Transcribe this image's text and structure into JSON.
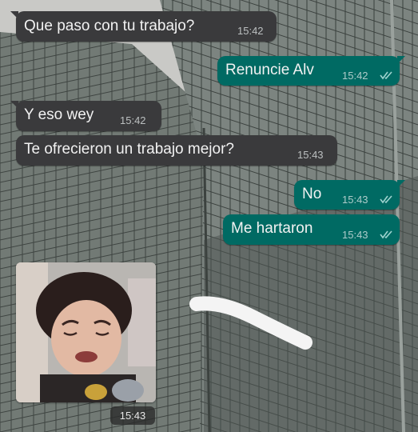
{
  "chat": {
    "messages": [
      {
        "direction": "incoming",
        "text": "Que paso con tu trabajo?",
        "time": "15:42"
      },
      {
        "direction": "outgoing",
        "text": "Renuncie Alv",
        "time": "15:42",
        "status": "read"
      },
      {
        "direction": "incoming",
        "text": "Y eso wey",
        "time": "15:42"
      },
      {
        "direction": "incoming",
        "text": "Te ofrecieron un trabajo mejor?",
        "time": "15:43"
      },
      {
        "direction": "outgoing",
        "text": "No",
        "time": "15:43",
        "status": "read"
      },
      {
        "direction": "outgoing",
        "text": "Me hartaron",
        "time": "15:43",
        "status": "read"
      },
      {
        "direction": "incoming",
        "type": "image",
        "image_desc": "crying-child-photo",
        "time": "15:43"
      }
    ]
  },
  "colors": {
    "incoming_bubble": "#3a3a3c",
    "outgoing_bubble": "#006a63",
    "read_ticks": "#9fd3cf"
  },
  "icons": {
    "read_receipt": "double-check-icon",
    "redaction": "white-scribble"
  }
}
